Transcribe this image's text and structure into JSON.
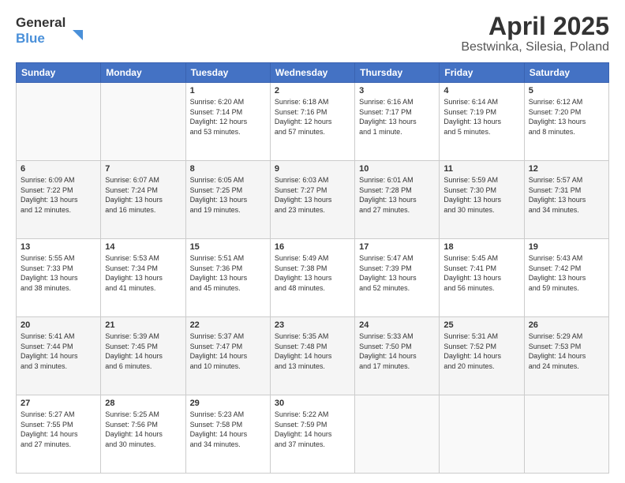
{
  "header": {
    "logo_line1": "General",
    "logo_line2": "Blue",
    "title": "April 2025",
    "subtitle": "Bestwinka, Silesia, Poland"
  },
  "weekdays": [
    "Sunday",
    "Monday",
    "Tuesday",
    "Wednesday",
    "Thursday",
    "Friday",
    "Saturday"
  ],
  "weeks": [
    [
      {
        "day": "",
        "info": ""
      },
      {
        "day": "",
        "info": ""
      },
      {
        "day": "1",
        "info": "Sunrise: 6:20 AM\nSunset: 7:14 PM\nDaylight: 12 hours\nand 53 minutes."
      },
      {
        "day": "2",
        "info": "Sunrise: 6:18 AM\nSunset: 7:16 PM\nDaylight: 12 hours\nand 57 minutes."
      },
      {
        "day": "3",
        "info": "Sunrise: 6:16 AM\nSunset: 7:17 PM\nDaylight: 13 hours\nand 1 minute."
      },
      {
        "day": "4",
        "info": "Sunrise: 6:14 AM\nSunset: 7:19 PM\nDaylight: 13 hours\nand 5 minutes."
      },
      {
        "day": "5",
        "info": "Sunrise: 6:12 AM\nSunset: 7:20 PM\nDaylight: 13 hours\nand 8 minutes."
      }
    ],
    [
      {
        "day": "6",
        "info": "Sunrise: 6:09 AM\nSunset: 7:22 PM\nDaylight: 13 hours\nand 12 minutes."
      },
      {
        "day": "7",
        "info": "Sunrise: 6:07 AM\nSunset: 7:24 PM\nDaylight: 13 hours\nand 16 minutes."
      },
      {
        "day": "8",
        "info": "Sunrise: 6:05 AM\nSunset: 7:25 PM\nDaylight: 13 hours\nand 19 minutes."
      },
      {
        "day": "9",
        "info": "Sunrise: 6:03 AM\nSunset: 7:27 PM\nDaylight: 13 hours\nand 23 minutes."
      },
      {
        "day": "10",
        "info": "Sunrise: 6:01 AM\nSunset: 7:28 PM\nDaylight: 13 hours\nand 27 minutes."
      },
      {
        "day": "11",
        "info": "Sunrise: 5:59 AM\nSunset: 7:30 PM\nDaylight: 13 hours\nand 30 minutes."
      },
      {
        "day": "12",
        "info": "Sunrise: 5:57 AM\nSunset: 7:31 PM\nDaylight: 13 hours\nand 34 minutes."
      }
    ],
    [
      {
        "day": "13",
        "info": "Sunrise: 5:55 AM\nSunset: 7:33 PM\nDaylight: 13 hours\nand 38 minutes."
      },
      {
        "day": "14",
        "info": "Sunrise: 5:53 AM\nSunset: 7:34 PM\nDaylight: 13 hours\nand 41 minutes."
      },
      {
        "day": "15",
        "info": "Sunrise: 5:51 AM\nSunset: 7:36 PM\nDaylight: 13 hours\nand 45 minutes."
      },
      {
        "day": "16",
        "info": "Sunrise: 5:49 AM\nSunset: 7:38 PM\nDaylight: 13 hours\nand 48 minutes."
      },
      {
        "day": "17",
        "info": "Sunrise: 5:47 AM\nSunset: 7:39 PM\nDaylight: 13 hours\nand 52 minutes."
      },
      {
        "day": "18",
        "info": "Sunrise: 5:45 AM\nSunset: 7:41 PM\nDaylight: 13 hours\nand 56 minutes."
      },
      {
        "day": "19",
        "info": "Sunrise: 5:43 AM\nSunset: 7:42 PM\nDaylight: 13 hours\nand 59 minutes."
      }
    ],
    [
      {
        "day": "20",
        "info": "Sunrise: 5:41 AM\nSunset: 7:44 PM\nDaylight: 14 hours\nand 3 minutes."
      },
      {
        "day": "21",
        "info": "Sunrise: 5:39 AM\nSunset: 7:45 PM\nDaylight: 14 hours\nand 6 minutes."
      },
      {
        "day": "22",
        "info": "Sunrise: 5:37 AM\nSunset: 7:47 PM\nDaylight: 14 hours\nand 10 minutes."
      },
      {
        "day": "23",
        "info": "Sunrise: 5:35 AM\nSunset: 7:48 PM\nDaylight: 14 hours\nand 13 minutes."
      },
      {
        "day": "24",
        "info": "Sunrise: 5:33 AM\nSunset: 7:50 PM\nDaylight: 14 hours\nand 17 minutes."
      },
      {
        "day": "25",
        "info": "Sunrise: 5:31 AM\nSunset: 7:52 PM\nDaylight: 14 hours\nand 20 minutes."
      },
      {
        "day": "26",
        "info": "Sunrise: 5:29 AM\nSunset: 7:53 PM\nDaylight: 14 hours\nand 24 minutes."
      }
    ],
    [
      {
        "day": "27",
        "info": "Sunrise: 5:27 AM\nSunset: 7:55 PM\nDaylight: 14 hours\nand 27 minutes."
      },
      {
        "day": "28",
        "info": "Sunrise: 5:25 AM\nSunset: 7:56 PM\nDaylight: 14 hours\nand 30 minutes."
      },
      {
        "day": "29",
        "info": "Sunrise: 5:23 AM\nSunset: 7:58 PM\nDaylight: 14 hours\nand 34 minutes."
      },
      {
        "day": "30",
        "info": "Sunrise: 5:22 AM\nSunset: 7:59 PM\nDaylight: 14 hours\nand 37 minutes."
      },
      {
        "day": "",
        "info": ""
      },
      {
        "day": "",
        "info": ""
      },
      {
        "day": "",
        "info": ""
      }
    ]
  ]
}
